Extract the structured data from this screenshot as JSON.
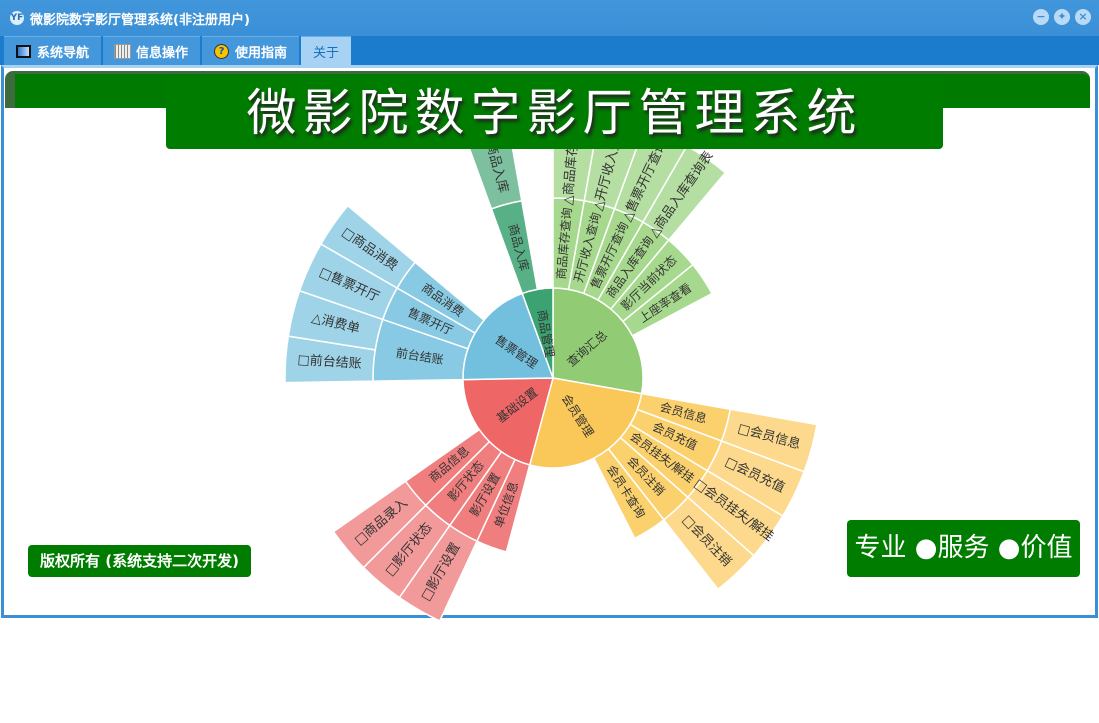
{
  "window": {
    "title": "微影院数字影厅管理系统(非注册用户)",
    "logo_text": "YF",
    "icons": [
      "minimize-icon",
      "restore-icon",
      "close-icon"
    ]
  },
  "tabs": [
    {
      "label": "系统导航",
      "icon": "monitor-icon"
    },
    {
      "label": "信息操作",
      "icon": "grid-icon"
    },
    {
      "label": "使用指南",
      "icon": "help-icon"
    },
    {
      "label": "关于",
      "active": true
    }
  ],
  "banner": {
    "title": "微影院数字影厅管理系统"
  },
  "footer": {
    "copyright": "版权所有 (系统支持二次开发)",
    "slogan": "专业 ●服务 ●价值"
  },
  "chart_data": {
    "type": "sunburst",
    "unit": "degrees",
    "children": [
      {
        "name": "查询汇总",
        "value": 100,
        "color": "#91cc75",
        "children": [
          {
            "name": "商品库存查询",
            "value": 10,
            "children": [
              {
                "name": "△商品库存查询表",
                "value": 10
              }
            ]
          },
          {
            "name": "开厅收入查询",
            "value": 10,
            "children": [
              {
                "name": "△开厅收入查询表",
                "value": 10
              }
            ]
          },
          {
            "name": "售票开厅查询",
            "value": 10,
            "children": [
              {
                "name": "△售票开厅查询表",
                "value": 10
              }
            ]
          },
          {
            "name": "商品入库查询",
            "value": 10,
            "children": [
              {
                "name": "△商品入库查询表",
                "value": 10
              }
            ]
          },
          {
            "name": "影厅当前状态",
            "value": 11
          },
          {
            "name": "上座率查看",
            "value": 11
          }
        ]
      },
      {
        "name": "会员管理",
        "value": 95,
        "color": "#fac858",
        "children": [
          {
            "name": "会员信息",
            "value": 10.5,
            "children": [
              {
                "name": "□会员信息",
                "value": 10.5
              }
            ]
          },
          {
            "name": "会员充值",
            "value": 10.5,
            "children": [
              {
                "name": "□会员充值",
                "value": 10.5
              }
            ]
          },
          {
            "name": "会员挂失/解挂",
            "value": 10.5,
            "children": [
              {
                "name": "□会员挂失/解挂",
                "value": 10.5
              }
            ]
          },
          {
            "name": "会员注销",
            "value": 10.5,
            "children": [
              {
                "name": "□会员注销",
                "value": 10.5
              }
            ]
          },
          {
            "name": "会员卡查询",
            "value": 11
          }
        ]
      },
      {
        "name": "基础设置",
        "value": 74,
        "color": "#ee6666",
        "children": [
          {
            "name": "单位信息",
            "value": 10
          },
          {
            "name": "影厅设置",
            "value": 10,
            "children": [
              {
                "name": "□影厅设置",
                "value": 10
              }
            ]
          },
          {
            "name": "影厅状态",
            "value": 10,
            "children": [
              {
                "name": "□影厅状态",
                "value": 10
              }
            ]
          },
          {
            "name": "商品信息",
            "value": 10,
            "children": [
              {
                "name": "□商品录入",
                "value": 10
              }
            ]
          }
        ]
      },
      {
        "name": "售票管理",
        "value": 71,
        "color": "#73c0de",
        "children": [
          {
            "name": "前台结账",
            "value": 20,
            "children": [
              {
                "name": "□前台结账",
                "value": 10
              },
              {
                "name": "△消费单",
                "value": 10
              }
            ]
          },
          {
            "name": "售票开厅",
            "value": 11,
            "children": [
              {
                "name": "□售票开厅",
                "value": 11
              }
            ]
          },
          {
            "name": "商品消费",
            "value": 10,
            "children": [
              {
                "name": "□商品消费",
                "value": 10
              }
            ]
          }
        ]
      },
      {
        "name": "商品管理",
        "value": 20,
        "color": "#3ba272",
        "children": [
          {
            "name": "商品入库",
            "value": 10,
            "children": [
              {
                "name": "□商品入库",
                "value": 10
              }
            ]
          }
        ]
      }
    ]
  }
}
